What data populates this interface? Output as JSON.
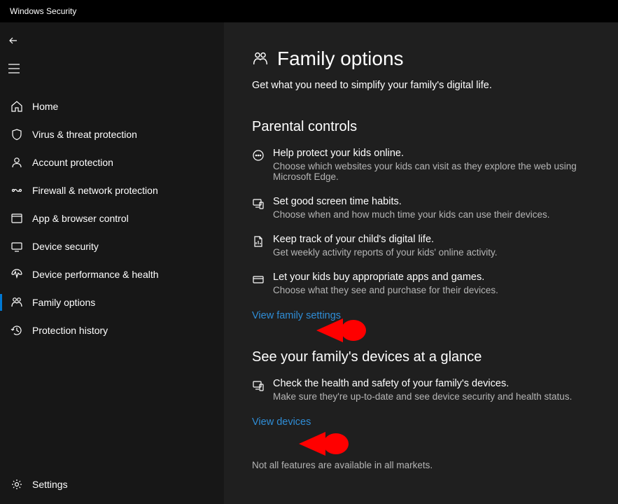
{
  "window": {
    "title": "Windows Security"
  },
  "sidebar": {
    "items": [
      {
        "label": "Home",
        "icon": "home-icon"
      },
      {
        "label": "Virus & threat protection",
        "icon": "shield-icon"
      },
      {
        "label": "Account protection",
        "icon": "account-icon"
      },
      {
        "label": "Firewall & network protection",
        "icon": "firewall-icon"
      },
      {
        "label": "App & browser control",
        "icon": "app-browser-icon"
      },
      {
        "label": "Device security",
        "icon": "device-security-icon"
      },
      {
        "label": "Device performance & health",
        "icon": "performance-icon"
      },
      {
        "label": "Family options",
        "icon": "family-icon",
        "selected": true
      },
      {
        "label": "Protection history",
        "icon": "history-icon"
      }
    ],
    "settings_label": "Settings"
  },
  "page": {
    "title": "Family options",
    "subtitle": "Get what you need to simplify your family's digital life.",
    "sections": [
      {
        "title": "Parental controls",
        "features": [
          {
            "icon": "web-protect-icon",
            "heading": "Help protect your kids online.",
            "desc": "Choose which websites your kids can visit as they explore the web using Microsoft Edge."
          },
          {
            "icon": "screen-time-icon",
            "heading": "Set good screen time habits.",
            "desc": "Choose when and how much time your kids can use their devices."
          },
          {
            "icon": "activity-report-icon",
            "heading": "Keep track of your child's digital life.",
            "desc": "Get weekly activity reports of your kids' online activity."
          },
          {
            "icon": "purchase-icon",
            "heading": "Let your kids buy appropriate apps and games.",
            "desc": "Choose what they see and purchase for their devices."
          }
        ],
        "link": "View family settings"
      },
      {
        "title": "See your family's devices at a glance",
        "features": [
          {
            "icon": "device-health-icon",
            "heading": "Check the health and safety of your family's devices.",
            "desc": "Make sure they're up-to-date and see device security and health status."
          }
        ],
        "link": "View devices"
      }
    ],
    "footnote": "Not all features are available in all markets."
  },
  "annotations": {
    "arrow_color": "#ff0000"
  }
}
